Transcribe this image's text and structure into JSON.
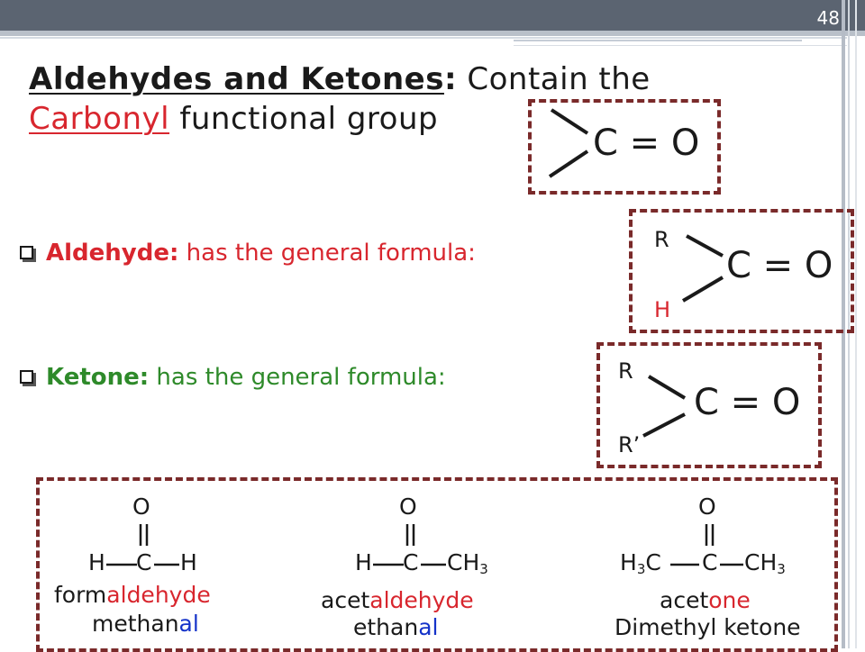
{
  "slide_number": "48",
  "title": {
    "bold_part": "Aldehydes and Ketones",
    "colon": ":",
    "rest": " Contain the",
    "carbonyl": "Carbonyl",
    "suffix": " functional group"
  },
  "carbonyl_group": {
    "formula": "C = O"
  },
  "aldehyde": {
    "label": "Aldehyde:",
    "text": " has the general formula:",
    "r": "R",
    "h": "H",
    "formula": "C = O"
  },
  "ketone": {
    "label": "Ketone:",
    "text": " has the general formula:",
    "r": "R",
    "r_prime": "R’",
    "formula": "C = O"
  },
  "examples": [
    {
      "oxygen": "O",
      "left": "H",
      "center": "C",
      "right": "H",
      "name_prefix": "form",
      "name_suffix": "aldehyde",
      "iupac_prefix": "methan",
      "iupac_suffix": "al"
    },
    {
      "oxygen": "O",
      "left": "H",
      "center": "C",
      "right": "CH",
      "right_sub": "3",
      "name_prefix": "acet",
      "name_suffix": "aldehyde",
      "iupac_prefix": "ethan",
      "iupac_suffix": "al"
    },
    {
      "oxygen": "O",
      "left": "H",
      "left_sub": "3",
      "left_tail": "C",
      "center": "C",
      "right": "CH",
      "right_sub": "3",
      "name_prefix": "acet",
      "name_suffix": "one",
      "common_name": "Dimethyl ketone"
    }
  ]
}
